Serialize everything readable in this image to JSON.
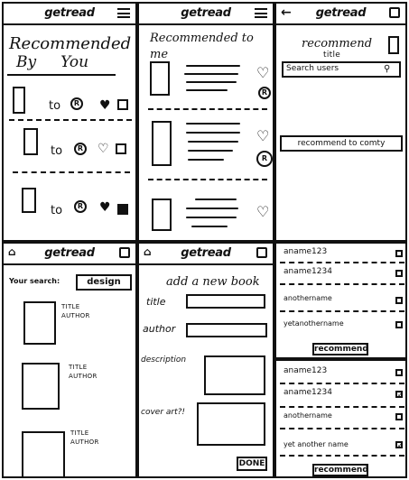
{
  "app": {
    "title": "getread"
  },
  "panel1": {
    "heading_line1": "Recommended",
    "heading_line2": "By     You",
    "rows": [
      {
        "to_label": "to",
        "avatar": "R"
      },
      {
        "to_label": "to",
        "avatar": "R"
      },
      {
        "to_label": "to",
        "avatar": "R"
      }
    ]
  },
  "panel2": {
    "heading": "Recommended to me"
  },
  "panel3": {
    "heading_line1": "recommend",
    "heading_line2": "title",
    "search_placeholder": "Search users",
    "community_button": "recommend to comty"
  },
  "panel4": {
    "search_label": "Your search:",
    "search_value": "design",
    "results": [
      {
        "title": "TITLE",
        "author": "AUTHOR"
      },
      {
        "title": "TITLE",
        "author": "AUTHOR"
      },
      {
        "title": "TITLE",
        "author": "AUTHOR"
      }
    ]
  },
  "panel5": {
    "heading": "add a new book",
    "title_label": "title",
    "author_label": "author",
    "description_label": "description",
    "cover_label": "cover art?!",
    "done_button": "DONE"
  },
  "panel6": {
    "users": [
      "aname123",
      "aname1234",
      "anothername",
      "yetanothername"
    ],
    "button": "recommend"
  },
  "panel7": {
    "users": [
      "aname123",
      "aname1234",
      "anothername",
      "yet another name"
    ],
    "checked": [
      false,
      true,
      false,
      true
    ],
    "button": "recommend"
  }
}
